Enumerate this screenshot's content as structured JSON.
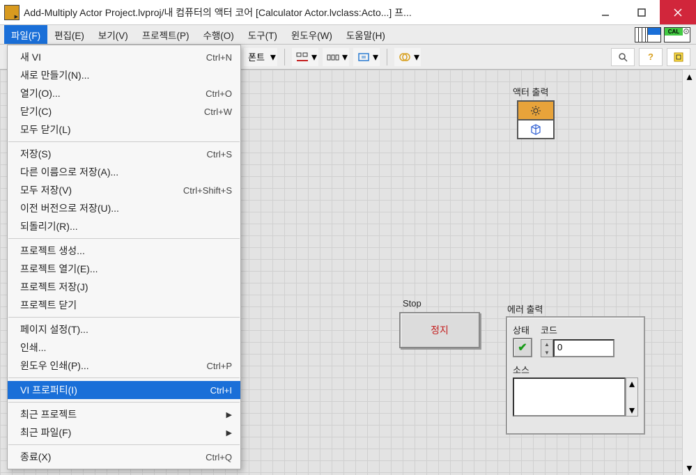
{
  "titlebar": {
    "title": "Add-Multiply Actor Project.lvproj/내 컴퓨터의 액터 코어 [Calculator Actor.lvclass:Acto...] 프..."
  },
  "menubar": {
    "items": [
      {
        "label": "파일(F)"
      },
      {
        "label": "편집(E)"
      },
      {
        "label": "보기(V)"
      },
      {
        "label": "프로젝트(P)"
      },
      {
        "label": "수행(O)"
      },
      {
        "label": "도구(T)"
      },
      {
        "label": "윈도우(W)"
      },
      {
        "label": "도움말(H)"
      }
    ],
    "pal2_label": "CAL"
  },
  "toolbar": {
    "font_label": "폰트"
  },
  "canvas": {
    "actor_label": "액터 출력",
    "stop_label": "Stop",
    "stop_text": "정지",
    "error_label": "에러 출력",
    "status_label": "상태",
    "code_label": "코드",
    "code_value": "0",
    "source_label": "소스"
  },
  "file_menu": {
    "groups": [
      [
        {
          "label": "새 VI",
          "shortcut": "Ctrl+N"
        },
        {
          "label": "새로 만들기(N)..."
        },
        {
          "label": "열기(O)...",
          "shortcut": "Ctrl+O"
        },
        {
          "label": "닫기(C)",
          "shortcut": "Ctrl+W"
        },
        {
          "label": "모두 닫기(L)"
        }
      ],
      [
        {
          "label": "저장(S)",
          "shortcut": "Ctrl+S"
        },
        {
          "label": "다른 이름으로 저장(A)..."
        },
        {
          "label": "모두 저장(V)",
          "shortcut": "Ctrl+Shift+S"
        },
        {
          "label": "이전 버전으로 저장(U)..."
        },
        {
          "label": "되돌리기(R)..."
        }
      ],
      [
        {
          "label": "프로젝트 생성..."
        },
        {
          "label": "프로젝트 열기(E)..."
        },
        {
          "label": "프로젝트 저장(J)"
        },
        {
          "label": "프로젝트 닫기"
        }
      ],
      [
        {
          "label": "페이지 설정(T)..."
        },
        {
          "label": "인쇄..."
        },
        {
          "label": "윈도우 인쇄(P)...",
          "shortcut": "Ctrl+P"
        }
      ],
      [
        {
          "label": "VI 프로퍼티(I)",
          "shortcut": "Ctrl+I",
          "highlight": true
        }
      ],
      [
        {
          "label": "최근 프로젝트",
          "submenu": true
        },
        {
          "label": "최근 파일(F)",
          "submenu": true
        }
      ],
      [
        {
          "label": "종료(X)",
          "shortcut": "Ctrl+Q"
        }
      ]
    ]
  }
}
